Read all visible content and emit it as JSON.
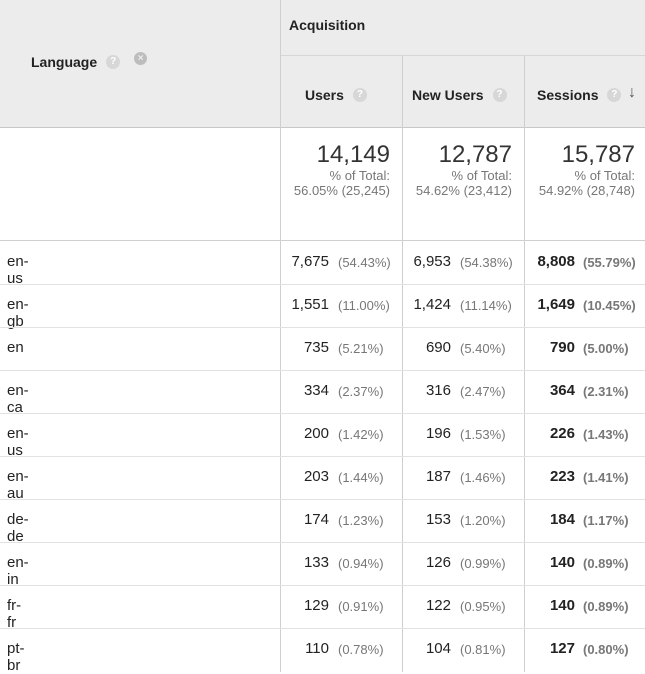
{
  "header": {
    "language_label": "Language",
    "group_label": "Acquisition",
    "columns": [
      "Users",
      "New Users",
      "Sessions"
    ],
    "help_glyph": "?",
    "remove_glyph": "×",
    "sort_glyph": "↓"
  },
  "totals": [
    {
      "value": "14,149",
      "label": "% of Total:",
      "detail": "56.05% (25,245)"
    },
    {
      "value": "12,787",
      "label": "% of Total:",
      "detail": "54.62% (23,412)"
    },
    {
      "value": "15,787",
      "label": "% of Total:",
      "detail": "54.92% (28,748)"
    }
  ],
  "rows": [
    {
      "lang": "en-us",
      "users": "7,675",
      "users_pct": "(54.43%)",
      "new": "6,953",
      "new_pct": "(54.38%)",
      "sessions": "8,808",
      "sessions_pct": "(55.79%)"
    },
    {
      "lang": "en-gb",
      "users": "1,551",
      "users_pct": "(11.00%)",
      "new": "1,424",
      "new_pct": "(11.14%)",
      "sessions": "1,649",
      "sessions_pct": "(10.45%)"
    },
    {
      "lang": "en",
      "users": "735",
      "users_pct": "(5.21%)",
      "new": "690",
      "new_pct": "(5.40%)",
      "sessions": "790",
      "sessions_pct": "(5.00%)"
    },
    {
      "lang": "en-ca",
      "users": "334",
      "users_pct": "(2.37%)",
      "new": "316",
      "new_pct": "(2.47%)",
      "sessions": "364",
      "sessions_pct": "(2.31%)"
    },
    {
      "lang": "en-us",
      "users": "200",
      "users_pct": "(1.42%)",
      "new": "196",
      "new_pct": "(1.53%)",
      "sessions": "226",
      "sessions_pct": "(1.43%)"
    },
    {
      "lang": "en-au",
      "users": "203",
      "users_pct": "(1.44%)",
      "new": "187",
      "new_pct": "(1.46%)",
      "sessions": "223",
      "sessions_pct": "(1.41%)"
    },
    {
      "lang": "de-de",
      "users": "174",
      "users_pct": "(1.23%)",
      "new": "153",
      "new_pct": "(1.20%)",
      "sessions": "184",
      "sessions_pct": "(1.17%)"
    },
    {
      "lang": "en-in",
      "users": "133",
      "users_pct": "(0.94%)",
      "new": "126",
      "new_pct": "(0.99%)",
      "sessions": "140",
      "sessions_pct": "(0.89%)"
    },
    {
      "lang": "fr-fr",
      "users": "129",
      "users_pct": "(0.91%)",
      "new": "122",
      "new_pct": "(0.95%)",
      "sessions": "140",
      "sessions_pct": "(0.89%)"
    },
    {
      "lang": "pt-br",
      "users": "110",
      "users_pct": "(0.78%)",
      "new": "104",
      "new_pct": "(0.81%)",
      "sessions": "127",
      "sessions_pct": "(0.80%)"
    }
  ]
}
